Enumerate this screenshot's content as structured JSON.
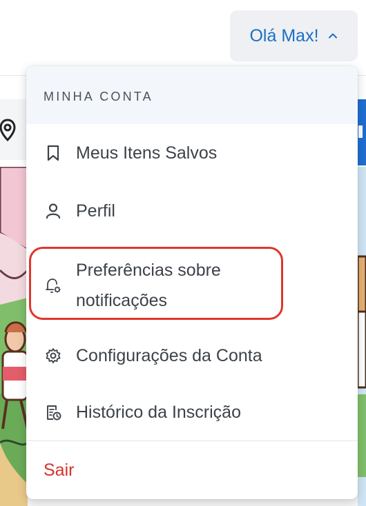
{
  "header": {
    "user_greeting": "Olá Max!",
    "chevron_icon": "chevron-up-icon"
  },
  "account_menu": {
    "section_title": "MINHA CONTA",
    "items": [
      {
        "label": "Meus Itens Salvos",
        "icon": "bookmark-icon"
      },
      {
        "label": "Perfil",
        "icon": "user-icon"
      },
      {
        "label": "Preferências sobre notificações",
        "icon": "bell-gear-icon"
      },
      {
        "label": "Configurações da Conta",
        "icon": "gear-icon"
      },
      {
        "label": "Histórico da Inscrição",
        "icon": "document-clock-icon"
      }
    ],
    "logout_label": "Sair"
  },
  "colors": {
    "accent_blue": "#1b6fc4",
    "highlight_red": "#e0352b",
    "logout_red": "#d5342b"
  }
}
